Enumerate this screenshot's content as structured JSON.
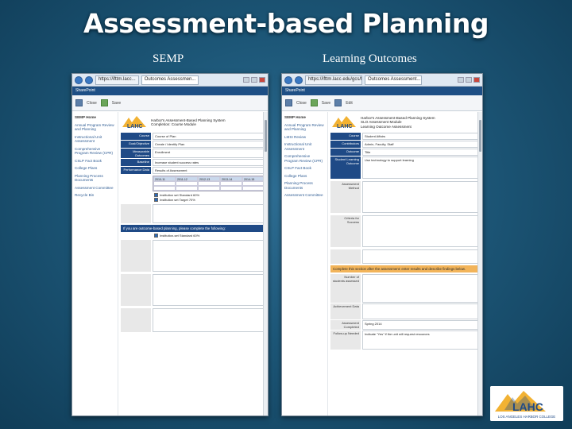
{
  "slide": {
    "title": "Assessment-based Planning",
    "caption_left": "SEMP",
    "caption_right": "Learning Outcomes"
  },
  "left_window": {
    "tabs": [
      "https://ifttm.lacc...",
      "Outcomes Assessmen..."
    ],
    "sp_bar": "SharePoint",
    "ribbon": [
      "Close",
      "Save"
    ],
    "nav": [
      "SEMP Home",
      "Annual Program Review and Planning",
      "Instructional Unit Assessment",
      "Comprehensive Program Review (CPR)",
      "CSLP Fact Book",
      "College Plans",
      "Planning Process Documents",
      "Assessment Committee",
      "Recycle Bin"
    ],
    "header_lines": [
      "Harbor's Assessment-Based Planning System",
      "Completion: Course Module"
    ],
    "fields": [
      {
        "label": "Course",
        "value": "Course of Plan"
      },
      {
        "label": "Goal/Objective",
        "value": "Create / Identify Plan"
      },
      {
        "label": "Measurable Outcomes",
        "value": "Enrollment"
      },
      {
        "label": "Baseline",
        "value": "Increase student success rates"
      },
      {
        "label": "Performance Data",
        "value": "Results of Assessment"
      }
    ],
    "table_header": [
      "2010-11",
      "2011-12",
      "2012-13",
      "2013-14",
      "2014-15"
    ],
    "checks": [
      "Institution set Standard 60%",
      "Institution set Target 70%"
    ],
    "blue_banner": "If you are outcome-based planning, please complete the following:",
    "check_extra": "Institution-set Standard 60%"
  },
  "right_window": {
    "tabs": [
      "https://ifttm.lacc.edu/gcs/flfx...",
      "Outcomes Assessment..."
    ],
    "sp_bar": "SharePoint",
    "ribbon": [
      "Close",
      "Save",
      "Edit"
    ],
    "nav": [
      "SEMP Home",
      "Annual Program Review and Planning",
      "LMSI Review",
      "Instructional Unit Assessment",
      "Comprehensive Program Review (CPR)",
      "CSLP Fact Book",
      "College Plans",
      "Planning Process Documents",
      "Assessment Committee"
    ],
    "header_lines": [
      "Harbor's Assessment-Based Planning System",
      "SLO Assessment Module",
      "Learning Outcome Assessment"
    ],
    "fields": [
      {
        "label": "Course",
        "value": "Student Affairs"
      },
      {
        "label": "Contributors",
        "value": "Admin, Faculty, Staff"
      },
      {
        "label": "Outcome",
        "value": "Title"
      },
      {
        "label": "Student Learning Outcome",
        "value": "Use technology to support learning"
      },
      {
        "label": "Assessment Method",
        "value": ""
      },
      {
        "label": "Criteria for Success",
        "value": ""
      }
    ],
    "orange_banner": "Complete this section after the assessment: enter results and describe findings below.",
    "bottom_fields": [
      {
        "label": "Number of students assessed",
        "value": ""
      },
      {
        "label": "Achievement Data",
        "value": ""
      },
      {
        "label": "Assessment Completed",
        "value": "Spring 2014"
      },
      {
        "label": "Follow-up Needed",
        "value": "Indicate \"Yes\" if the unit will request resources"
      }
    ]
  },
  "logo": {
    "text": "LAHC",
    "subtext": "LOS ANGELES HARBOR COLLEGE"
  }
}
